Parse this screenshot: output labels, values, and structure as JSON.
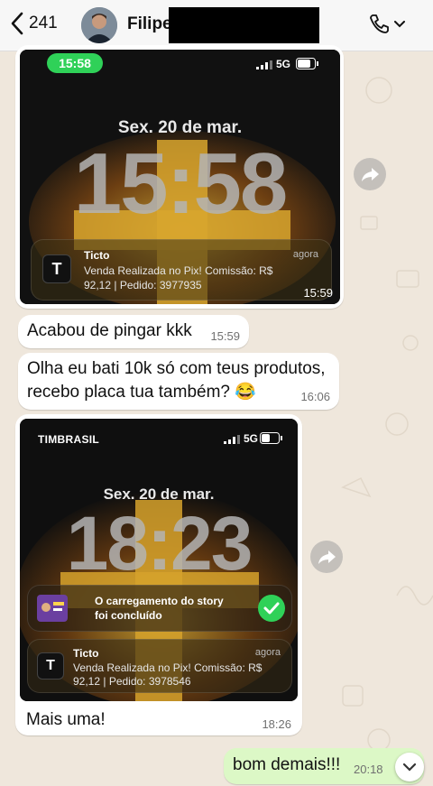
{
  "header": {
    "back_count": "241",
    "contact_name": "Filipe"
  },
  "messages": {
    "shot1": {
      "status_time": "15:58",
      "network": "5G",
      "date": "Sex. 20 de mar.",
      "clock": "15:58",
      "notification": {
        "app": "Ticto",
        "ago": "agora",
        "line1": "Venda Realizada no Pix! Comissão: R$",
        "line2": "92,12 | Pedido: 3977935"
      },
      "time": "15:59"
    },
    "msg1": {
      "text": "Acabou de pingar kkk",
      "time": "15:59"
    },
    "msg2": {
      "line1": "Olha eu bati 10k só com teus produtos,",
      "line2": "recebo placa tua também? 😂",
      "time": "16:06"
    },
    "shot2": {
      "carrier": "TIMBRASIL",
      "network": "5G",
      "date": "Sex. 20 de mar.",
      "clock": "18:23",
      "story": {
        "line1": "O carregamento do story",
        "line2": "foi concluído"
      },
      "notification": {
        "app": "Ticto",
        "ago": "agora",
        "line1": "Venda Realizada no Pix! Comissão: R$",
        "line2": "92,12 | Pedido: 3978546"
      },
      "caption": "Mais uma!",
      "time": "18:26"
    },
    "msg3": {
      "text": "bom demais!!!",
      "time": "20:18"
    }
  },
  "colors": {
    "accent_green": "#2fd158",
    "outgoing": "#dcf8c6",
    "incoming": "#ffffff"
  }
}
